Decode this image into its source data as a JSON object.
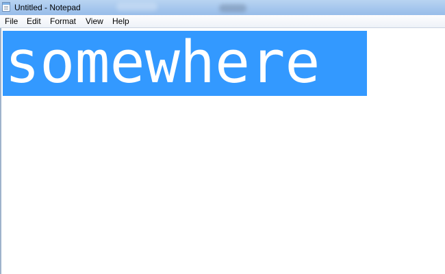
{
  "window": {
    "title": "Untitled - Notepad",
    "icon": "notepad-icon"
  },
  "menu": {
    "items": [
      {
        "label": "File"
      },
      {
        "label": "Edit"
      },
      {
        "label": "Format"
      },
      {
        "label": "View"
      },
      {
        "label": "Help"
      }
    ]
  },
  "editor": {
    "content": "somewhere",
    "selected": true,
    "selection_color": "#3399ff",
    "selected_text_color": "#ffffff"
  }
}
